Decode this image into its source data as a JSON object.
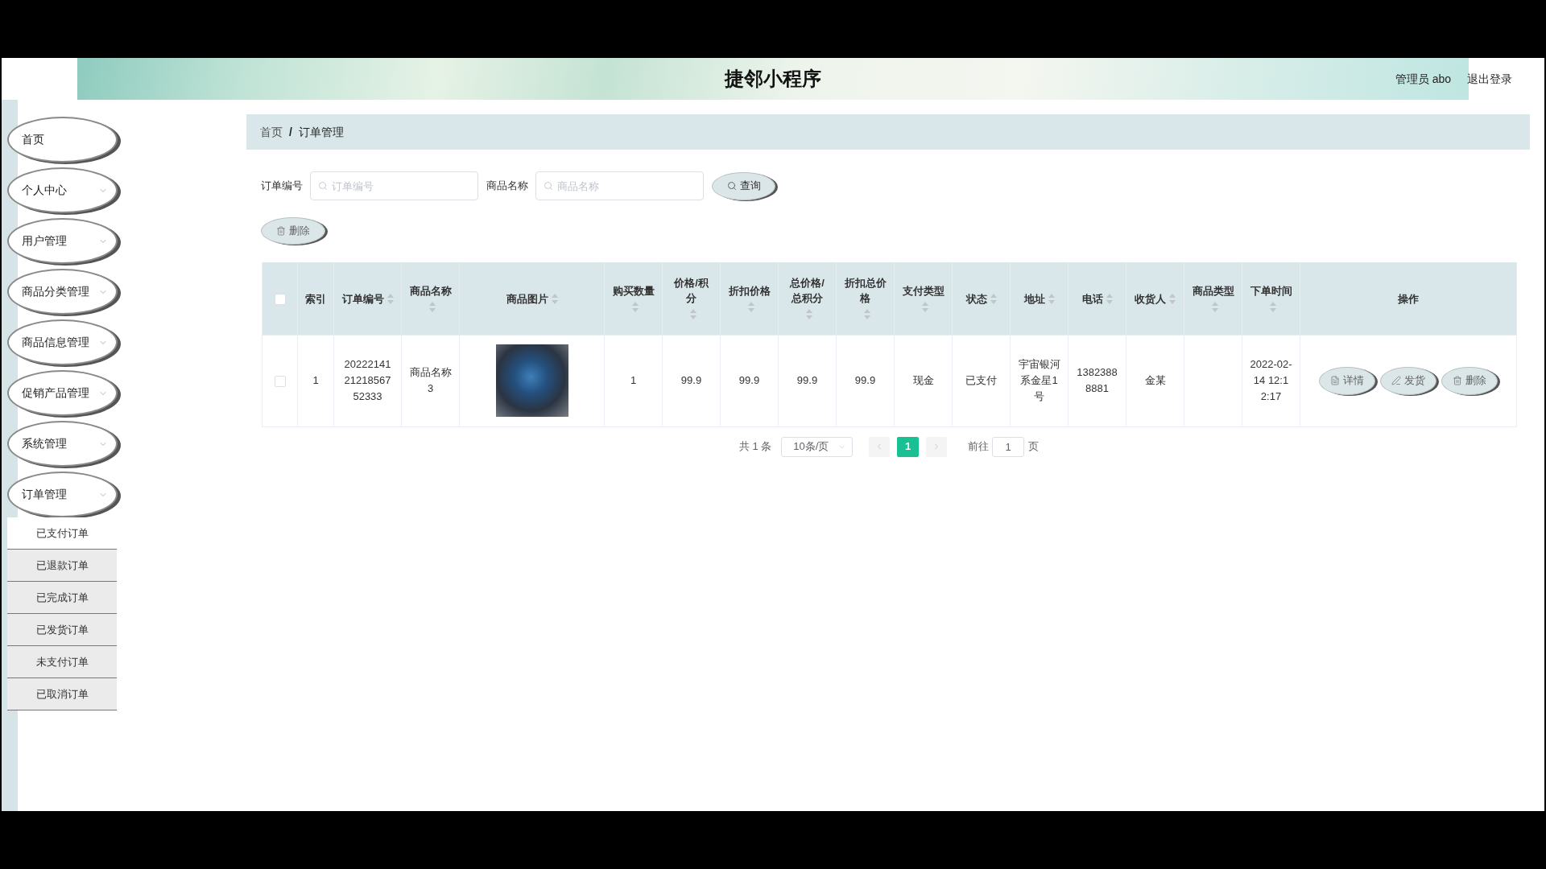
{
  "header": {
    "title": "捷邻小程序",
    "user": "管理员 abo",
    "logout": "退出登录"
  },
  "sidebar": {
    "items": [
      {
        "label": "首页",
        "kind": "link"
      },
      {
        "label": "个人中心",
        "kind": "menu"
      },
      {
        "label": "用户管理",
        "kind": "menu"
      },
      {
        "label": "商品分类管理",
        "kind": "menu"
      },
      {
        "label": "商品信息管理",
        "kind": "menu"
      },
      {
        "label": "促销产品管理",
        "kind": "menu"
      },
      {
        "label": "系统管理",
        "kind": "menu"
      },
      {
        "label": "订单管理",
        "kind": "menu",
        "children": [
          {
            "label": "已支付订单",
            "selected": true
          },
          {
            "label": "已退款订单",
            "selected": false
          },
          {
            "label": "已完成订单",
            "selected": false
          },
          {
            "label": "已发货订单",
            "selected": false
          },
          {
            "label": "未支付订单",
            "selected": false
          },
          {
            "label": "已取消订单",
            "selected": false
          }
        ]
      }
    ]
  },
  "breadcrumb": {
    "items": [
      "首页",
      "订单管理"
    ],
    "separator": "/"
  },
  "search": {
    "fields": [
      {
        "label": "订单编号",
        "placeholder": "订单编号"
      },
      {
        "label": "商品名称",
        "placeholder": "商品名称"
      }
    ],
    "button": "查询"
  },
  "toolbar": {
    "buttons": [
      "删除"
    ]
  },
  "table": {
    "select_all": {
      "checked": false
    },
    "columns": [
      {
        "label": "索引",
        "sortable": false
      },
      {
        "label": "订单编号",
        "sortable": true
      },
      {
        "label": "商品名称",
        "sortable": true
      },
      {
        "label": "商品图片",
        "sortable": true
      },
      {
        "label": "购买数量",
        "sortable": true
      },
      {
        "label": "价格/积分",
        "sortable": true
      },
      {
        "label": "折扣价格",
        "sortable": true
      },
      {
        "label": "总价格/总积分",
        "sortable": true
      },
      {
        "label": "折扣总价格",
        "sortable": true
      },
      {
        "label": "支付类型",
        "sortable": true
      },
      {
        "label": "状态",
        "sortable": true
      },
      {
        "label": "地址",
        "sortable": true
      },
      {
        "label": "电话",
        "sortable": true
      },
      {
        "label": "收货人",
        "sortable": true
      },
      {
        "label": "商品类型",
        "sortable": true
      },
      {
        "label": "下单时间",
        "sortable": true
      },
      {
        "label": "操作",
        "sortable": false
      }
    ],
    "rows": [
      {
        "checked": false,
        "cells": [
          {
            "kind": "text",
            "text": "1"
          },
          {
            "kind": "text",
            "text": "202221412121856752333"
          },
          {
            "kind": "text",
            "text": "商品名称3"
          },
          {
            "kind": "image"
          },
          {
            "kind": "text",
            "text": "1"
          },
          {
            "kind": "text",
            "text": "99.9"
          },
          {
            "kind": "text",
            "text": "99.9"
          },
          {
            "kind": "text",
            "text": "99.9"
          },
          {
            "kind": "text",
            "text": "99.9"
          },
          {
            "kind": "text",
            "text": "现金"
          },
          {
            "kind": "text",
            "text": "已支付"
          },
          {
            "kind": "text",
            "text": "宇宙银河系金星1号"
          },
          {
            "kind": "text",
            "text": "13823888881"
          },
          {
            "kind": "text",
            "text": "金某"
          },
          {
            "kind": "blank"
          },
          {
            "kind": "text",
            "text": "2022-02-14 12:12:17"
          },
          {
            "kind": "actions",
            "buttons": [
              "详情",
              "发货",
              "删除"
            ]
          }
        ]
      }
    ]
  },
  "pagination": {
    "total": "共 1 条",
    "page_size": "10条/页",
    "prev": {
      "disabled": true
    },
    "pages": [
      {
        "label": "1",
        "selected": true
      }
    ],
    "next": {
      "disabled": true
    },
    "goto_label": "前往",
    "goto_value": "1",
    "goto_suffix": "页"
  }
}
